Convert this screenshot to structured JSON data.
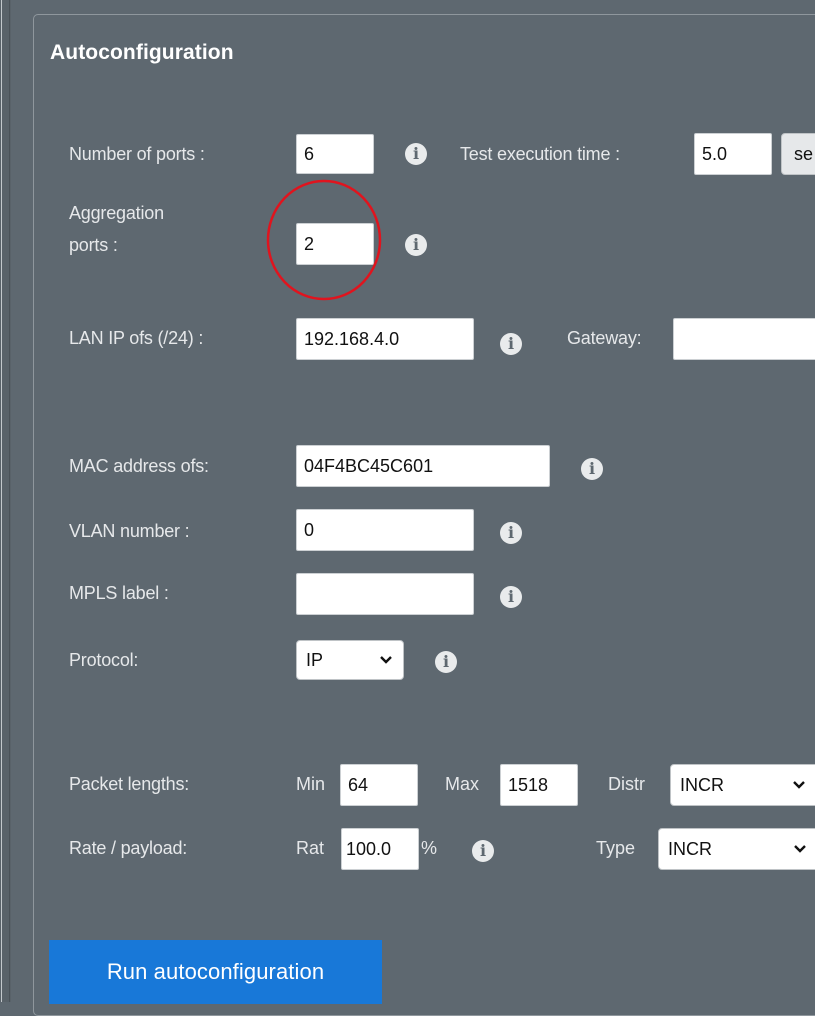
{
  "section": {
    "title": "Autoconfiguration"
  },
  "fields": {
    "num_ports": {
      "label": "Number of ports :",
      "value": "6"
    },
    "test_exec_time": {
      "label": "Test execution time :",
      "value": "5.0",
      "unit_button": "se"
    },
    "aggregation_ports": {
      "label_line1": "Aggregation",
      "label_line2": "ports :",
      "value": "2"
    },
    "lan_ip": {
      "label": "LAN IP ofs (/24) :",
      "value": "192.168.4.0"
    },
    "gateway": {
      "label": "Gateway:",
      "value": ""
    },
    "mac_address": {
      "label": "MAC address ofs:",
      "value": "04F4BC45C601"
    },
    "vlan_number": {
      "label": "VLAN number :",
      "value": "0"
    },
    "mpls_label": {
      "label": "MPLS label :",
      "value": ""
    },
    "protocol": {
      "label": "Protocol:",
      "selected": "IP"
    },
    "packet_lengths": {
      "label": "Packet lengths:",
      "min_label": "Min",
      "min_value": "64",
      "max_label": "Max",
      "max_value": "1518",
      "distr_label": "Distr",
      "distr_selected": "INCR"
    },
    "rate_payload": {
      "label": "Rate / payload:",
      "rat_label": "Rat",
      "rat_value": "100.0",
      "percent": "%",
      "type_label": "Type",
      "type_selected": "INCR"
    }
  },
  "actions": {
    "run_label": "Run autoconfiguration"
  },
  "icons": {
    "info": "info-icon",
    "chevron": "chevron-down-icon"
  },
  "colors": {
    "panel_bg": "#5e6870",
    "button_bg": "#1878d8",
    "highlight_circle": "#e0141e"
  }
}
